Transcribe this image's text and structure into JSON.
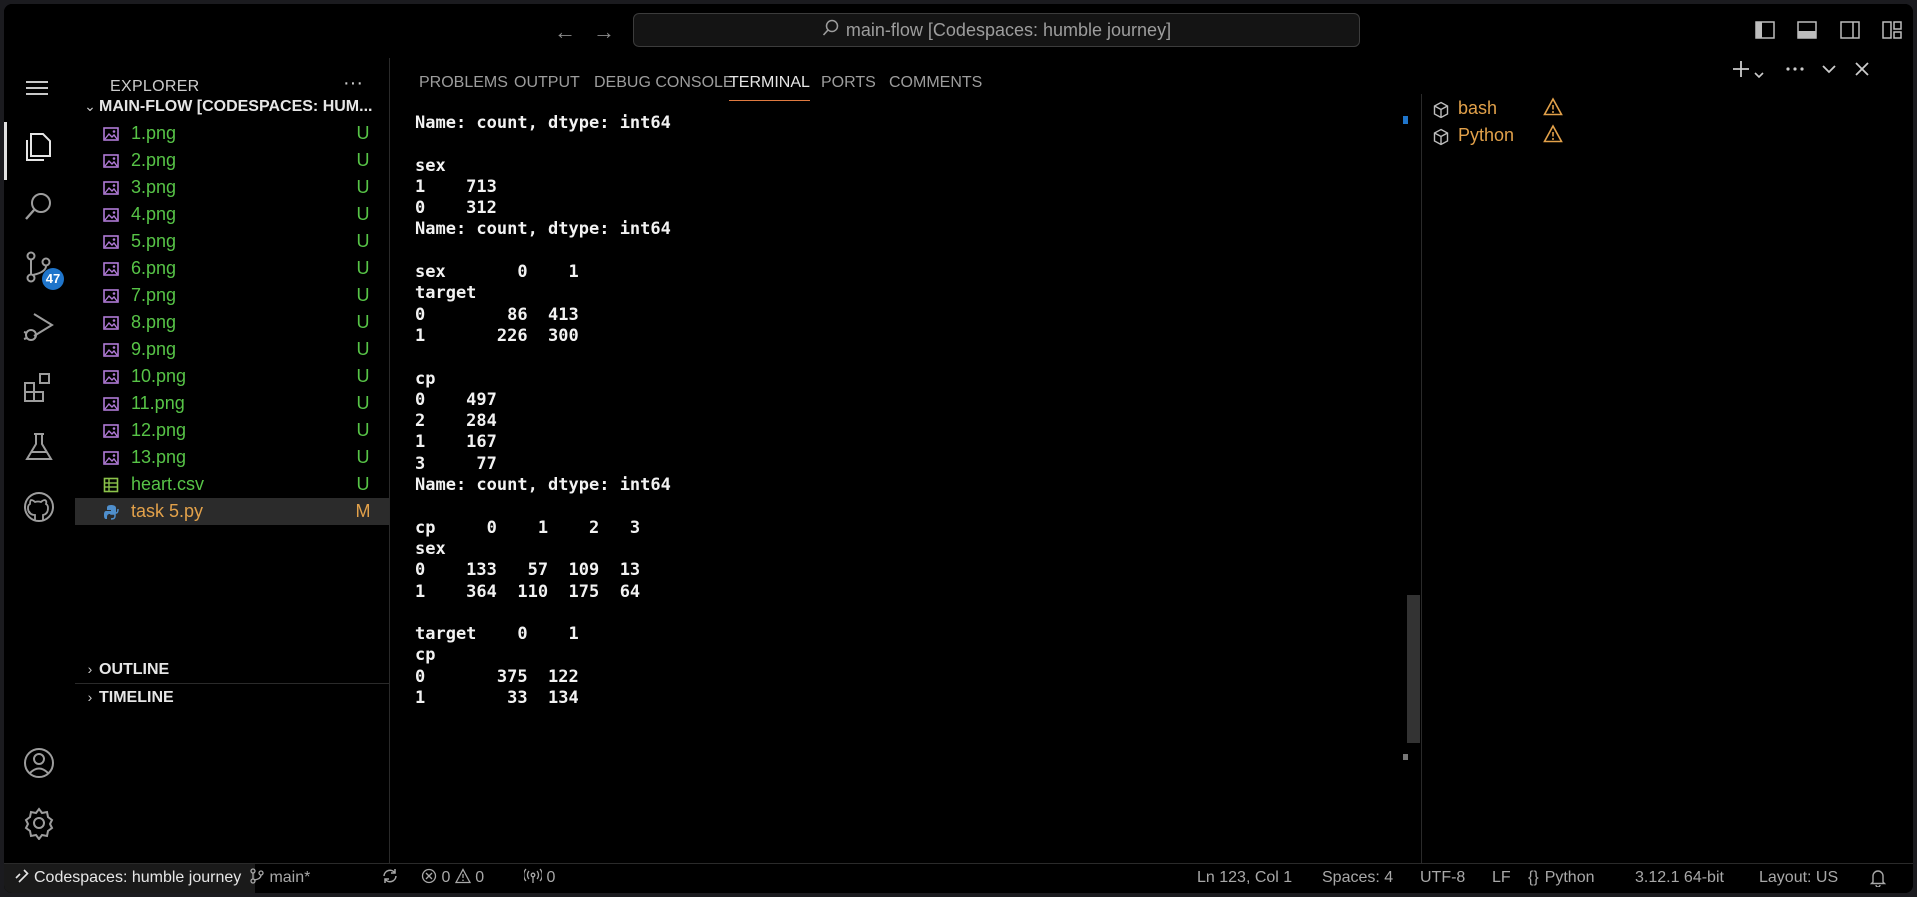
{
  "titlebar": {
    "back_label": "←",
    "forward_label": "→",
    "command_center": "main-flow [Codespaces: humble journey]"
  },
  "activity": {
    "source_control_badge": "47"
  },
  "explorer": {
    "title": "EXPLORER",
    "more": "···",
    "root_label": "MAIN-FLOW [CODESPACES: HUM...",
    "files": [
      {
        "name": "1.png",
        "status": "U"
      },
      {
        "name": "2.png",
        "status": "U"
      },
      {
        "name": "3.png",
        "status": "U"
      },
      {
        "name": "4.png",
        "status": "U"
      },
      {
        "name": "5.png",
        "status": "U"
      },
      {
        "name": "6.png",
        "status": "U"
      },
      {
        "name": "7.png",
        "status": "U"
      },
      {
        "name": "8.png",
        "status": "U"
      },
      {
        "name": "9.png",
        "status": "U"
      },
      {
        "name": "10.png",
        "status": "U"
      },
      {
        "name": "11.png",
        "status": "U"
      },
      {
        "name": "12.png",
        "status": "U"
      },
      {
        "name": "13.png",
        "status": "U"
      },
      {
        "name": "heart.csv",
        "status": "U"
      },
      {
        "name": "task 5.py",
        "status": "M"
      }
    ],
    "outline_label": "OUTLINE",
    "timeline_label": "TIMELINE"
  },
  "panel": {
    "tabs": [
      "PROBLEMS",
      "OUTPUT",
      "DEBUG CONSOLE",
      "TERMINAL",
      "PORTS",
      "COMMENTS"
    ],
    "active_tab": "TERMINAL",
    "terminal_lines": [
      "Name: count, dtype: int64",
      "",
      "sex",
      "1    713",
      "0    312",
      "Name: count, dtype: int64",
      "",
      "sex       0    1",
      "target",
      "0        86  413",
      "1       226  300",
      "",
      "cp",
      "0    497",
      "2    284",
      "1    167",
      "3     77",
      "Name: count, dtype: int64",
      "",
      "cp     0    1    2   3",
      "sex",
      "0    133   57  109  13",
      "1    364  110  175  64",
      "",
      "target    0    1",
      "cp",
      "0       375  122",
      "1        33  134"
    ],
    "terminals": [
      {
        "name": "bash"
      },
      {
        "name": "Python"
      }
    ]
  },
  "statusbar": {
    "remote": "Codespaces: humble journey",
    "branch": "main*",
    "errors": "0",
    "warnings": "0",
    "ports": "0",
    "position": "Ln 123, Col 1",
    "spaces": "Spaces: 4",
    "encoding": "UTF-8",
    "eol": "LF",
    "language": "Python",
    "interpreter": "3.12.1 64-bit",
    "layout": "Layout: US"
  },
  "colors": {
    "untracked": "#57c447",
    "modified": "#e2a14a",
    "accent": "#1f75cb",
    "tab_underline": "#e07a40"
  }
}
